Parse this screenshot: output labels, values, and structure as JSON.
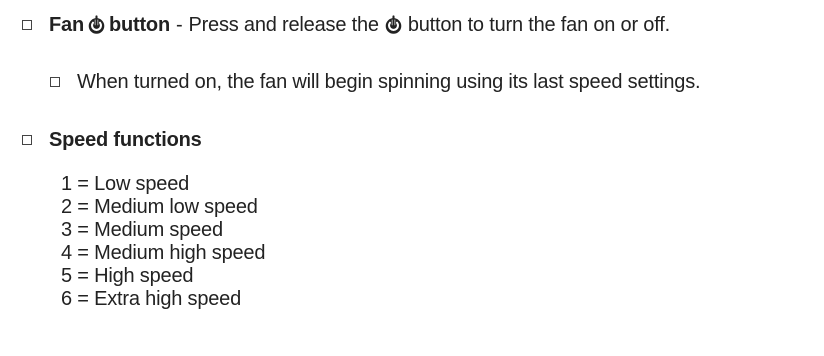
{
  "fan_button": {
    "title_pre": "Fan",
    "title_post": "button",
    "separator": "-",
    "desc_pre": "Press and release the",
    "desc_post": "button to turn the fan on or off.",
    "icon": "power-icon"
  },
  "note": "When turned on, the fan will begin spinning using its last speed settings.",
  "speed": {
    "heading": "Speed functions",
    "items": [
      "1 = Low speed",
      "2 = Medium low speed",
      "3 = Medium speed",
      "4 = Medium high speed",
      "5 = High speed",
      "6 = Extra high speed"
    ]
  }
}
